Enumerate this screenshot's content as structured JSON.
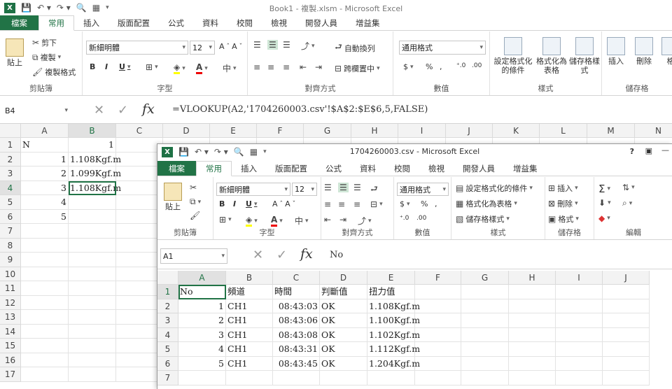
{
  "main": {
    "title": "Book1 - 複製.xlsm - Microsoft Excel",
    "tabs": [
      "檔案",
      "常用",
      "插入",
      "版面配置",
      "公式",
      "資料",
      "校閱",
      "檢視",
      "開發人員",
      "增益集"
    ],
    "clipboard": {
      "paste": "貼上",
      "cut": "剪下",
      "copy": "複製",
      "format_painter": "複製格式",
      "label": "剪貼簿"
    },
    "font": {
      "name": "新細明體",
      "size": "12",
      "label": "字型"
    },
    "alignment": {
      "wrap": "自動換列",
      "merge": "跨欄置中",
      "label": "對齊方式"
    },
    "number": {
      "format": "通用格式",
      "label": "數值"
    },
    "styles": {
      "conditional": "設定格式化的條件",
      "as_table": "格式化為表格",
      "cell_styles": "儲存格樣式",
      "label": "樣式"
    },
    "cells": {
      "insert": "插入",
      "delete": "刪除",
      "format": "格",
      "label": "儲存格"
    },
    "name_box": "B4",
    "formula": "=VLOOKUP(A2,'1704260003.csv'!$A$2:$E$6,5,FALSE)",
    "columns": [
      "A",
      "B",
      "C",
      "D",
      "E",
      "F",
      "G",
      "H",
      "I",
      "J",
      "K",
      "L",
      "M",
      "N"
    ],
    "rows": [
      "1",
      "2",
      "3",
      "4",
      "5",
      "6",
      "7",
      "8",
      "9",
      "10",
      "11",
      "12",
      "13",
      "14",
      "15",
      "16",
      "17"
    ],
    "cells_data": [
      {
        "a": "N",
        "b": "1"
      },
      {
        "a": "1",
        "b": "1.108Kgf.m"
      },
      {
        "a": "2",
        "b": "1.099Kgf.m"
      },
      {
        "a": "3",
        "b": "1.108Kgf.m"
      },
      {
        "a": "4",
        "b": ""
      },
      {
        "a": "5",
        "b": ""
      }
    ]
  },
  "csv": {
    "title": "1704260003.csv - Microsoft Excel",
    "help": "?",
    "tabs": [
      "檔案",
      "常用",
      "插入",
      "版面配置",
      "公式",
      "資料",
      "校閱",
      "檢視",
      "開發人員",
      "增益集"
    ],
    "clipboard": {
      "paste": "貼上",
      "label": "剪貼簿"
    },
    "font": {
      "name": "新細明體",
      "size": "12",
      "label": "字型"
    },
    "alignment": {
      "label": "對齊方式"
    },
    "number": {
      "format": "通用格式",
      "label": "數值"
    },
    "styles": {
      "conditional": "設定格式化的條件",
      "as_table": "格式化為表格",
      "cell_styles": "儲存格樣式",
      "label": "樣式"
    },
    "cells": {
      "insert": "插入",
      "delete": "刪除",
      "format": "格式",
      "label": "儲存格"
    },
    "editing": {
      "label": "編輯"
    },
    "name_box": "A1",
    "formula": "No",
    "columns": [
      "A",
      "B",
      "C",
      "D",
      "E",
      "F",
      "G",
      "H",
      "I",
      "J"
    ],
    "rows": [
      "1",
      "2",
      "3",
      "4",
      "5",
      "6",
      "7"
    ],
    "header": [
      "No",
      "頻道",
      "時間",
      "判斷值",
      "扭力值"
    ],
    "data": [
      [
        "1",
        "CH1",
        "08:43:03",
        "OK",
        "1.108Kgf.m"
      ],
      [
        "2",
        "CH1",
        "08:43:06",
        "OK",
        "1.100Kgf.m"
      ],
      [
        "3",
        "CH1",
        "08:43:08",
        "OK",
        "1.102Kgf.m"
      ],
      [
        "4",
        "CH1",
        "08:43:31",
        "OK",
        "1.112Kgf.m"
      ],
      [
        "5",
        "CH1",
        "08:43:45",
        "OK",
        "1.204Kgf.m"
      ]
    ]
  }
}
